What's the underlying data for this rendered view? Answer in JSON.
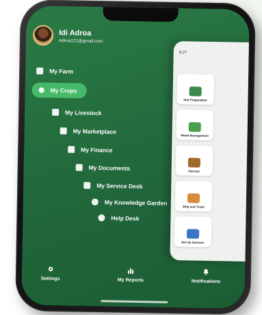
{
  "profile": {
    "name": "Idi Adroa",
    "email": "Adroa121@gmail.com"
  },
  "menu": {
    "items": [
      {
        "label": "My Farm",
        "icon": "house-icon"
      },
      {
        "label": "My Crops",
        "icon": "sprout-icon",
        "active": true
      },
      {
        "label": "My Livestock",
        "icon": "cow-icon"
      },
      {
        "label": "My Marketplace",
        "icon": "store-icon"
      },
      {
        "label": "My Finance",
        "icon": "wallet-icon"
      },
      {
        "label": "My Documents",
        "icon": "document-icon"
      },
      {
        "label": "My Service Desk",
        "icon": "desk-icon"
      },
      {
        "label": "My Knowledge Garden",
        "icon": "info-icon"
      },
      {
        "label": "Help Desk",
        "icon": "help-icon"
      }
    ]
  },
  "panel": {
    "status_time": "9:27",
    "cards": [
      {
        "label": "Soil Preparation"
      },
      {
        "label": "Weed Management"
      },
      {
        "label": "Harvest"
      },
      {
        "label": "Ship and Track"
      },
      {
        "label": "Set Up Sensors"
      }
    ]
  },
  "bottom_nav": {
    "items": [
      {
        "label": "Settings",
        "icon": "gear-icon"
      },
      {
        "label": "My Reports",
        "icon": "bar-chart-icon"
      },
      {
        "label": "Notifications",
        "icon": "bell-icon"
      }
    ]
  },
  "colors": {
    "drawer": "#236b3b",
    "active_pill": "#46b96a",
    "panel": "#eef1ee"
  }
}
